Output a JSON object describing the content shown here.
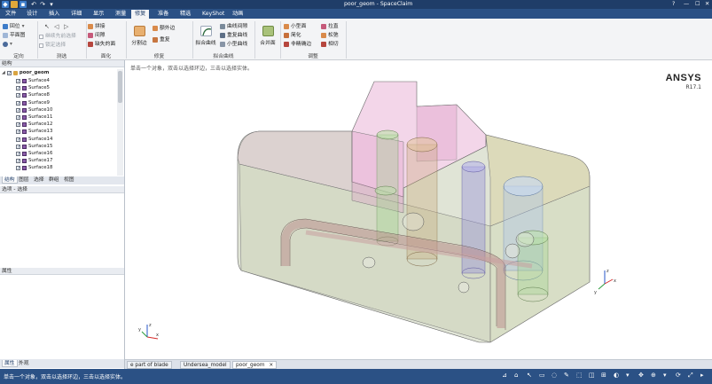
{
  "window": {
    "title": "poor_geom - SpaceClaim",
    "help": "?",
    "minimize": "—",
    "maximize": "☐",
    "close": "✕"
  },
  "menu": {
    "tabs": [
      "文件",
      "设计",
      "插入",
      "详细",
      "显示",
      "测量",
      "修复",
      "准备",
      "精选",
      "KeyShot",
      "动画"
    ],
    "active_index": 6
  },
  "ribbon": {
    "orient": {
      "label": "定向",
      "items": [
        "回位",
        "平面图"
      ]
    },
    "select": {
      "label": "测选",
      "options": [
        "继续先前选择",
        "锁定选择"
      ]
    },
    "surface": {
      "label": "面化",
      "items": [
        "拼接",
        "间隙",
        "缺失的面"
      ]
    },
    "repair": {
      "label": "修复",
      "split_edge": "分割边",
      "items": [
        "额外边",
        "重复"
      ]
    },
    "curves": {
      "label": "拟合曲线",
      "fit": "拟合曲线",
      "items": [
        "曲线间隙",
        "重复曲线",
        "小型曲线"
      ]
    },
    "merge": {
      "label": "合并面"
    },
    "adjust": {
      "label": "调整",
      "col1": [
        "小型面",
        "简化",
        "非精确边"
      ],
      "col2": [
        "拉直",
        "松弛",
        "相切"
      ]
    }
  },
  "structure": {
    "header": "结构",
    "root": "poor_geom",
    "items": [
      "Surface4",
      "Surface5",
      "Surface8",
      "Surface9",
      "Surface10",
      "Surface11",
      "Surface12",
      "Surface13",
      "Surface14",
      "Surface15",
      "Surface16",
      "Surface17",
      "Surface18"
    ]
  },
  "panel_tabs": [
    "结构",
    "图层",
    "选择",
    "群组",
    "视图"
  ],
  "options": {
    "header": "选项 - 选择"
  },
  "properties": {
    "header": "属性",
    "tabs": [
      "属性",
      "外观"
    ]
  },
  "viewport": {
    "hint": "单击一个对象，双击以选择环边，三击以选择实体。",
    "logo": "ANSYS",
    "version": "R17.1",
    "triad": {
      "x": "x",
      "y": "y",
      "z": "z"
    }
  },
  "documents": {
    "tabs": [
      "e part of blade",
      "Undersea_model",
      "poor_geom"
    ],
    "close": "×"
  },
  "status": {
    "text": "单击一个对象，双击以选择环边，三击以选择实体。"
  },
  "colors": {
    "title_bar": "#1f3d68",
    "menu_bar": "#2b5185",
    "status_bar": "#2b5185",
    "ribbon": "#f3f4f6"
  }
}
